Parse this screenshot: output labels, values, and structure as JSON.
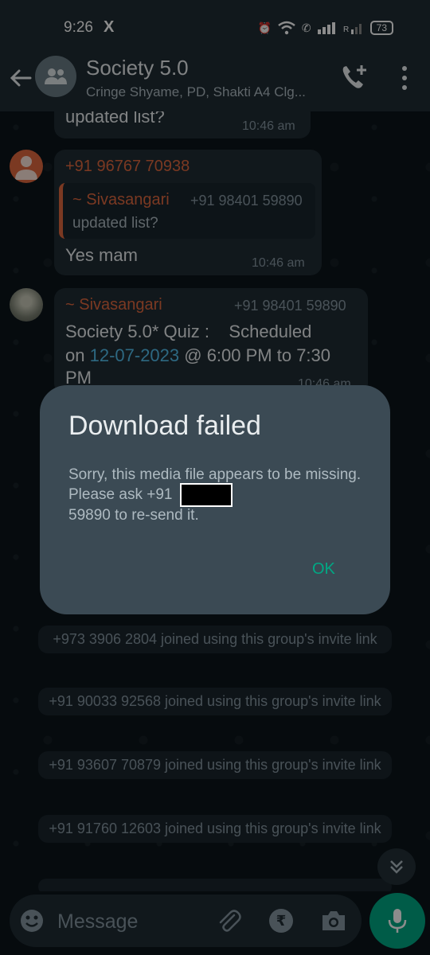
{
  "status": {
    "time": "9:26",
    "x_icon": "X",
    "battery": "73"
  },
  "header": {
    "title": "Society 5.0",
    "subtitle": "Cringe Shyame, PD, Shakti A4 Clg..."
  },
  "messages": [
    {
      "text": "updated list?",
      "time": "10:46 am"
    },
    {
      "sender": "+91 96767 70938",
      "quoted_sender": "~ Sivasangari",
      "quoted_phone": "+91 98401 59890",
      "quoted_text": "updated list?",
      "text": "Yes mam",
      "time": "10:46 am"
    },
    {
      "sender": "~ Sivasangari",
      "phone": "+91 98401 59890",
      "text_line1": "Society 5.0* Quiz :    Scheduled",
      "text_on": "on ",
      "text_date": "12-07-2023",
      "text_after": " @ 6:00 PM to 7:30",
      "text_line3": "PM",
      "time": "10:46 am"
    }
  ],
  "system_messages": [
    "+973 3906 2804 joined using this group's invite link",
    "+91 90033 92568 joined using this group's invite link",
    "+91 93607 70879 joined using this group's invite link",
    "+91 91760 12603 joined using this group's invite link"
  ],
  "dialog": {
    "title": "Download failed",
    "body_before": "Sorry, this media file appears to be missing. Please ask +91",
    "body_after": "59890 to re-send it.",
    "ok": "OK"
  },
  "input": {
    "placeholder": "Message"
  },
  "colors": {
    "accent": "#00a884",
    "sender_orange": "#e0683e",
    "link_blue": "#53bdeb"
  }
}
